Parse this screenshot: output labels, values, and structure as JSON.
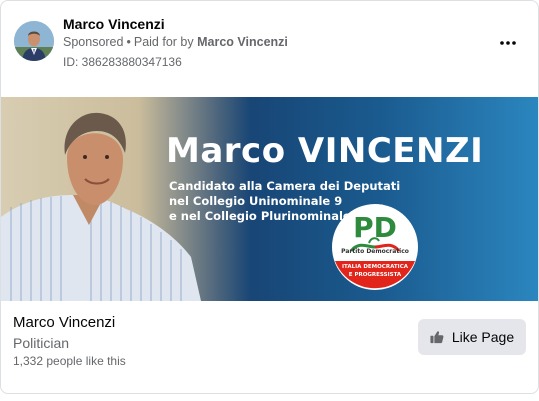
{
  "ad": {
    "advertiser": "Marco Vincenzi",
    "sponsored": "Sponsored",
    "separator": "•",
    "paid_for_by_label": "Paid for by",
    "payer": "Marco Vincenzi",
    "id_text": "ID: 386283880347136",
    "more_icon": "more-horizontal-icon"
  },
  "banner": {
    "name": "Marco VINCENZI",
    "subtitle_lines": [
      "Candidato alla Camera dei Deputati",
      "nel Collegio Uninominale 9",
      "e nel Collegio Plurinominale 2"
    ],
    "logo": {
      "letters": "PD",
      "party": "Partito Democratico",
      "ribbon_line1": "ITALIA DEMOCRATICA",
      "ribbon_line2": "E PROGRESSISTA"
    }
  },
  "page": {
    "name": "Marco Vincenzi",
    "category": "Politician",
    "likes": "1,332 people like this",
    "like_button": "Like Page",
    "like_icon": "thumbs-up-icon"
  },
  "colors": {
    "border": "#dddfe2",
    "secondary_text": "#65676b",
    "button_bg": "#e4e6eb",
    "banner_blue": "#17406f",
    "pd_green": "#2e8b3d",
    "pd_red": "#e1251b"
  }
}
